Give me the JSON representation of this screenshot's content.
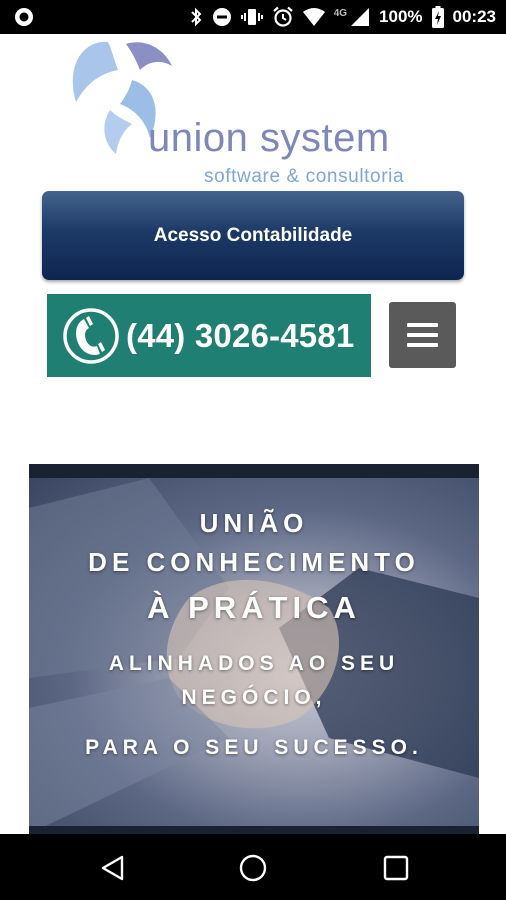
{
  "status_bar": {
    "network": "4G",
    "battery": "100%",
    "time": "00:23",
    "icons": [
      "bluetooth-icon",
      "do-not-disturb-icon",
      "vibrate-icon",
      "alarm-icon",
      "wifi-icon",
      "signal-icon",
      "battery-charging-icon"
    ]
  },
  "logo": {
    "name": "union system",
    "tagline": "software & consultoria",
    "colors": {
      "name": "#7f86b8",
      "tagline": "#7fa6d6",
      "swirl_light": "#a9c6ea",
      "swirl_dark": "#8b8fc4"
    }
  },
  "acesso_button": {
    "label": "Acesso Contabilidade"
  },
  "phone": {
    "number": "(44) 3026-4581",
    "icon": "phone-icon",
    "color": "#1f7f72"
  },
  "menu": {
    "icon": "hamburger-menu-icon"
  },
  "banner": {
    "line1": "UNIÃO",
    "line2": "DE CONHECIMENTO",
    "line3": "À PRÁTICA",
    "line4": "ALINHADOS AO SEU",
    "line5": "NEGÓCIO,",
    "line6": "PARA O SEU SUCESSO."
  },
  "nav_bar": {
    "icons": [
      "back-icon",
      "home-icon",
      "recent-apps-icon"
    ]
  }
}
